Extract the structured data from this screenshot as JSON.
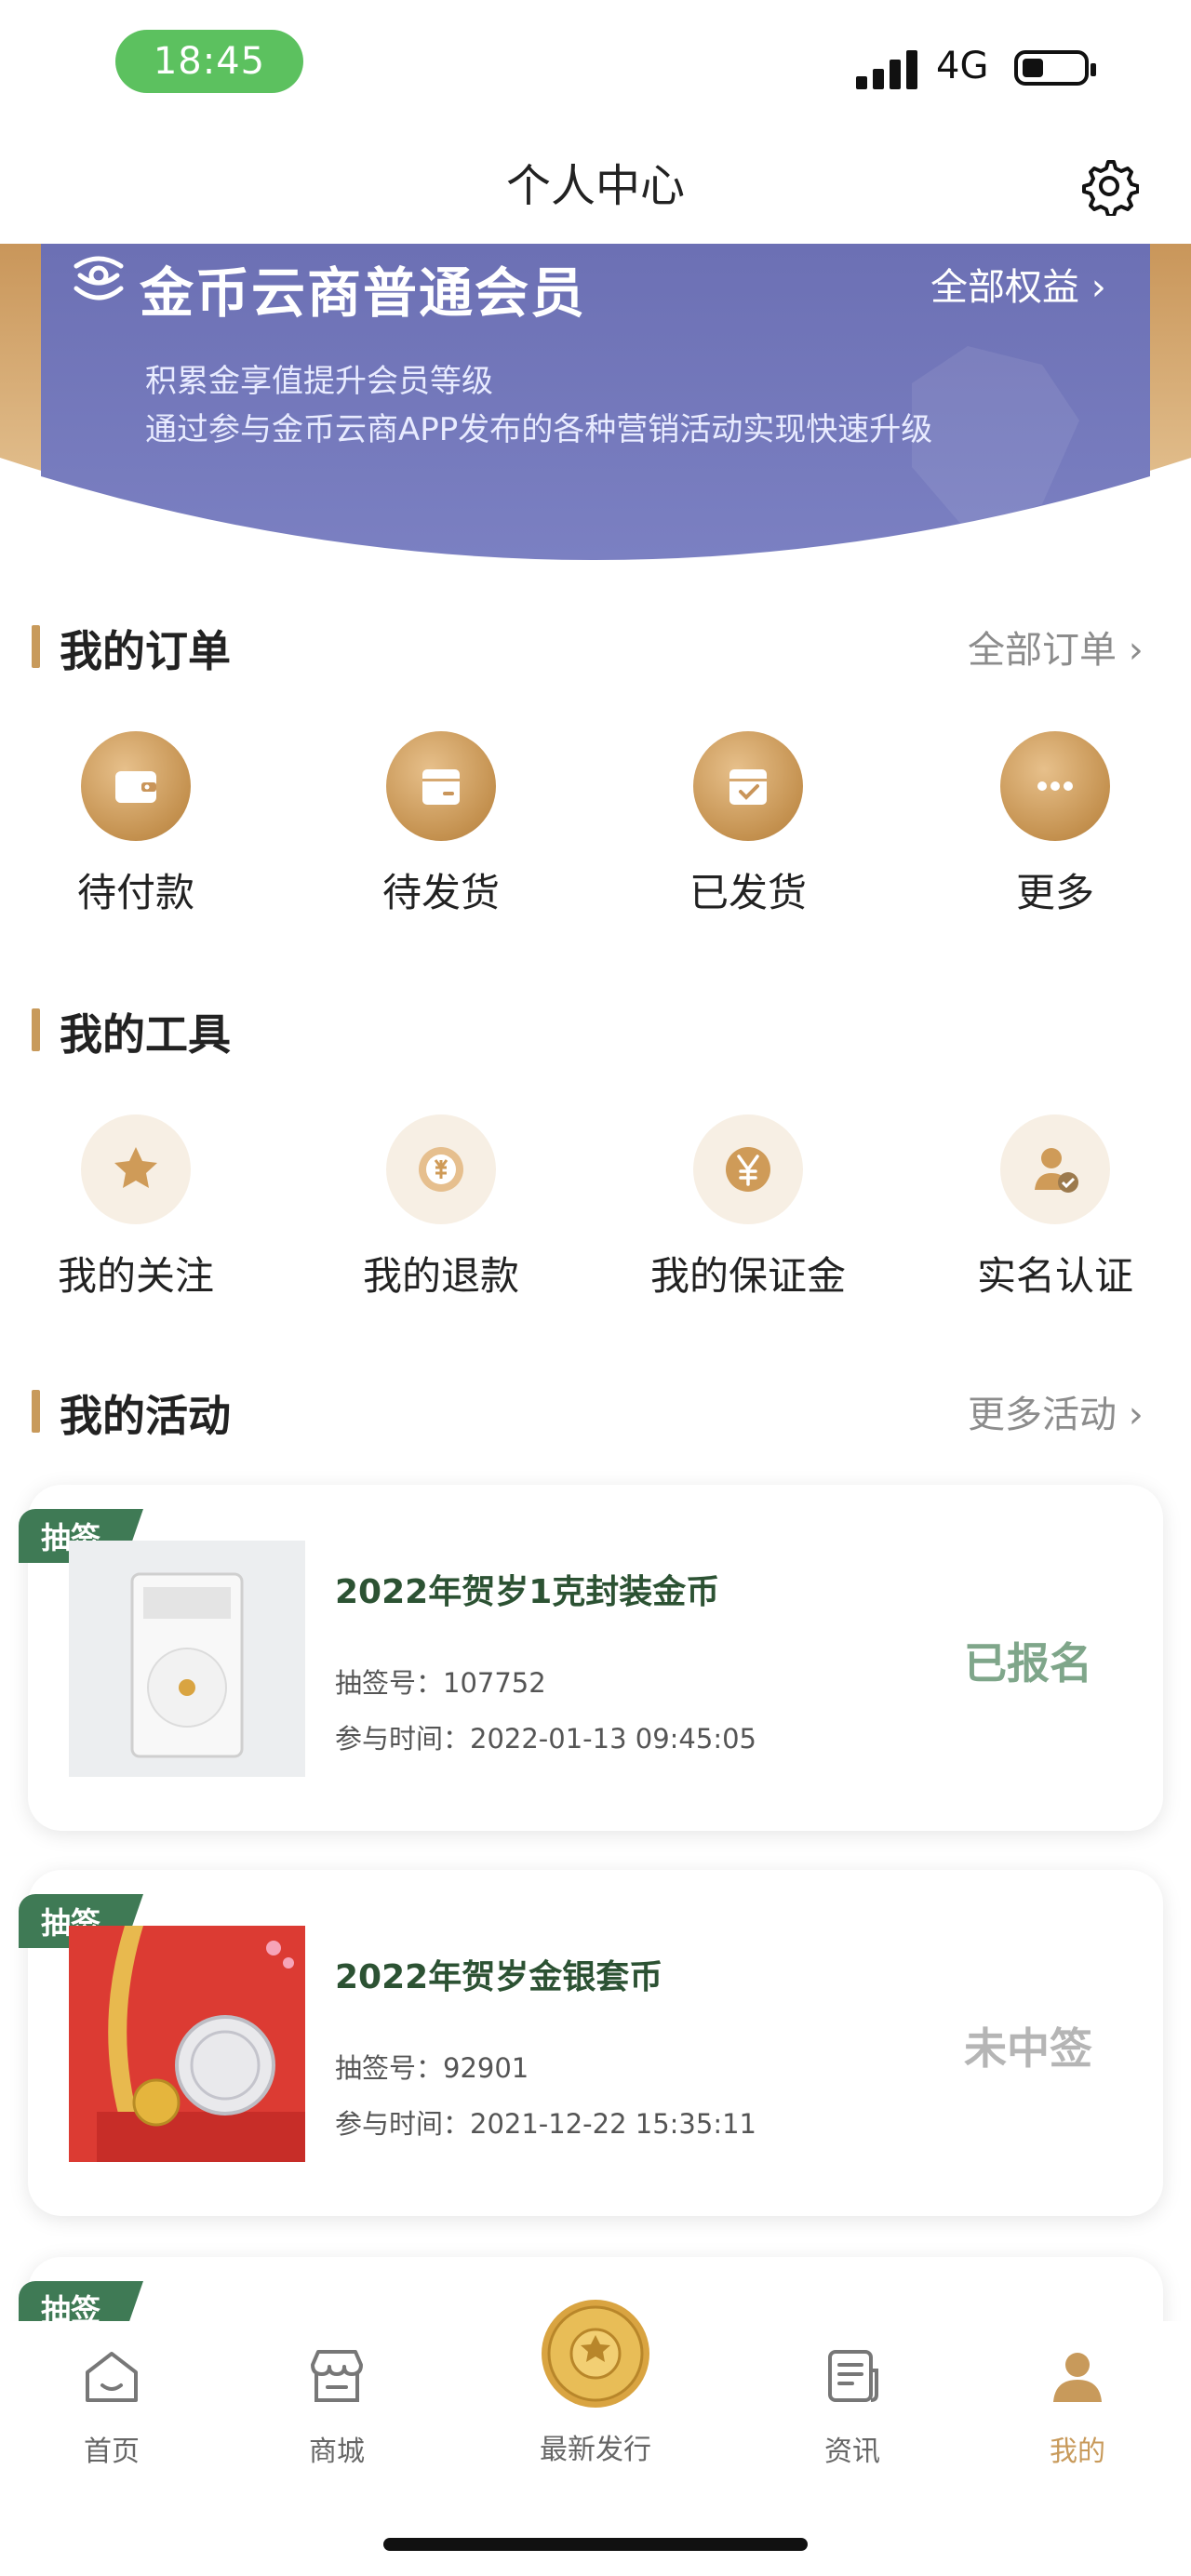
{
  "status_bar": {
    "time": "18:45",
    "network": "4G"
  },
  "header": {
    "title": "个人中心"
  },
  "banner": {
    "member_title": "金币云商普通会员",
    "benefits_link": "全部权益 ›",
    "desc_line1": "积累金享值提升会员等级",
    "desc_line2": "通过参与金币云商APP发布的各种营销活动实现快速升级"
  },
  "orders": {
    "title": "我的订单",
    "link": "全部订单 ›",
    "items": [
      {
        "label": "待付款",
        "icon": "wallet-icon"
      },
      {
        "label": "待发货",
        "icon": "box-icon"
      },
      {
        "label": "已发货",
        "icon": "shipped-box-icon"
      },
      {
        "label": "更多",
        "icon": "more-dots-icon"
      }
    ]
  },
  "tools": {
    "title": "我的工具",
    "items": [
      {
        "label": "我的关注",
        "icon": "star-icon"
      },
      {
        "label": "我的退款",
        "icon": "refund-icon"
      },
      {
        "label": "我的保证金",
        "icon": "yen-deposit-icon"
      },
      {
        "label": "实名认证",
        "icon": "verified-user-icon"
      }
    ]
  },
  "activities": {
    "title": "我的活动",
    "link": "更多活动 ›",
    "cards": [
      {
        "tag": "抽签",
        "title": "2022年贺岁1克封装金币",
        "lottery_no": "抽签号：107752",
        "join_time": "参与时间：2022-01-13 09:45:05",
        "status": "已报名"
      },
      {
        "tag": "抽签",
        "title": "2022年贺岁金银套币",
        "lottery_no": "抽签号：92901",
        "join_time": "参与时间：2021-12-22 15:35:11",
        "status": "未中签"
      },
      {
        "tag": "抽签"
      }
    ]
  },
  "bottom_nav": {
    "items": [
      {
        "label": "首页",
        "icon": "home-icon"
      },
      {
        "label": "商城",
        "icon": "store-icon"
      },
      {
        "label": "最新发行",
        "icon": "gold-coin-icon"
      },
      {
        "label": "资讯",
        "icon": "news-icon"
      },
      {
        "label": "我的",
        "icon": "profile-icon",
        "active": true
      }
    ],
    "active_color": "#c89a5b"
  },
  "colors": {
    "accent_gold": "#c89a5b",
    "banner": "#7075b8",
    "tag_green": "#3f7a55"
  }
}
